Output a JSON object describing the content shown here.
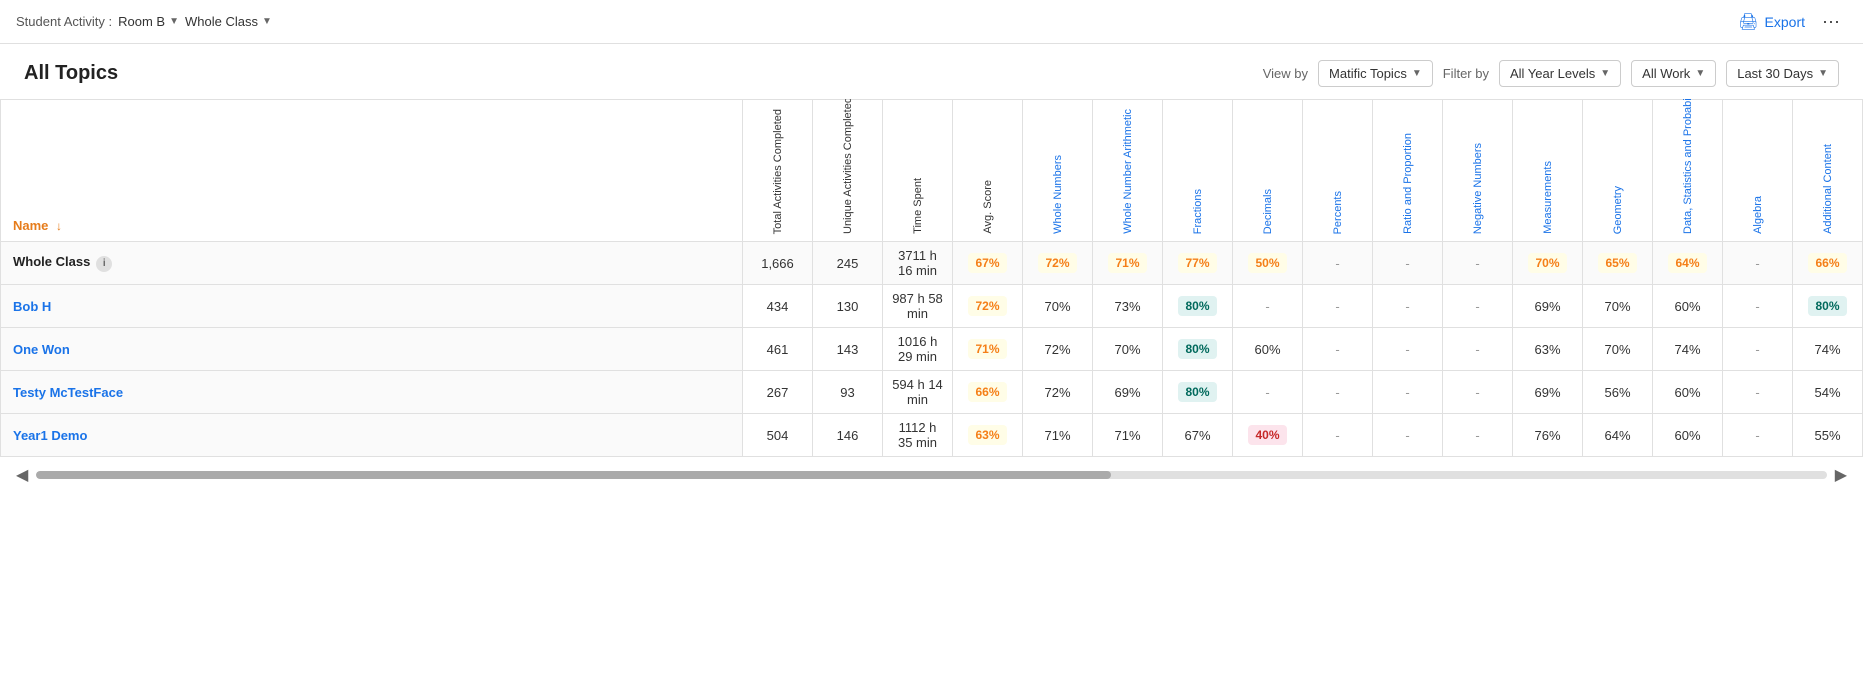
{
  "header": {
    "student_activity_label": "Student Activity :",
    "room_label": "Room B",
    "class_label": "Whole Class",
    "export_label": "Export",
    "more_icon": "···"
  },
  "title_section": {
    "title": "All Topics",
    "view_by_label": "View by",
    "view_by_value": "Matific Topics",
    "filter_by_label": "Filter by",
    "year_level_value": "All Year Levels",
    "work_value": "All Work",
    "date_value": "Last 30 Days"
  },
  "table": {
    "columns": {
      "name": "Name",
      "total_activities": "Total Activities Completed",
      "unique_activities": "Unique Activities Completed",
      "time_spent": "Time Spent",
      "avg_score": "Avg. Score",
      "whole_numbers": "Whole Numbers",
      "whole_number_arithmetic": "Whole Number Arithmetic",
      "fractions": "Fractions",
      "decimals": "Decimals",
      "percents": "Percents",
      "ratio_proportion": "Ratio and Proportion",
      "negative_numbers": "Negative Numbers",
      "measurements": "Measurements",
      "geometry": "Geometry",
      "data_statistics": "Data, Statistics and Probability",
      "algebra": "Algebra",
      "additional_content": "Additional Content"
    },
    "rows": [
      {
        "name": "Whole Class",
        "is_class": true,
        "total": "1,666",
        "unique": "245",
        "time": "3711 h 16 min",
        "avg": "67%",
        "avg_color": "yellow",
        "whole_numbers": "72%",
        "wn_color": "yellow",
        "wna": "71%",
        "wna_color": "yellow",
        "fractions": "77%",
        "frac_color": "yellow",
        "decimals": "50%",
        "dec_color": "yellow",
        "percents": "-",
        "ratio": "-",
        "negative": "-",
        "measurements": "70%",
        "meas_color": "yellow",
        "geometry": "65%",
        "geo_color": "yellow",
        "data_stats": "64%",
        "ds_color": "yellow",
        "algebra": "-",
        "additional": "66%",
        "add_color": "yellow"
      },
      {
        "name": "Bob H",
        "is_class": false,
        "total": "434",
        "unique": "130",
        "time": "987 h 58 min",
        "avg": "72%",
        "avg_color": "yellow",
        "whole_numbers": "70%",
        "wn_color": "plain",
        "wna": "73%",
        "wna_color": "plain",
        "fractions": "80%",
        "frac_color": "teal",
        "decimals": "-",
        "dec_color": "",
        "percents": "-",
        "ratio": "-",
        "negative": "-",
        "measurements": "69%",
        "meas_color": "plain",
        "geometry": "70%",
        "geo_color": "plain",
        "data_stats": "60%",
        "ds_color": "plain",
        "algebra": "-",
        "additional": "80%",
        "add_color": "teal"
      },
      {
        "name": "One Won",
        "is_class": false,
        "total": "461",
        "unique": "143",
        "time": "1016 h 29 min",
        "avg": "71%",
        "avg_color": "yellow",
        "whole_numbers": "72%",
        "wn_color": "plain",
        "wna": "70%",
        "wna_color": "plain",
        "fractions": "80%",
        "frac_color": "teal",
        "decimals": "60%",
        "dec_color": "plain",
        "percents": "-",
        "ratio": "-",
        "negative": "-",
        "measurements": "63%",
        "meas_color": "plain",
        "geometry": "70%",
        "geo_color": "plain",
        "data_stats": "74%",
        "ds_color": "plain",
        "algebra": "-",
        "additional": "74%",
        "add_color": "plain"
      },
      {
        "name": "Testy McTestFace",
        "is_class": false,
        "total": "267",
        "unique": "93",
        "time": "594 h 14 min",
        "avg": "66%",
        "avg_color": "yellow",
        "whole_numbers": "72%",
        "wn_color": "plain",
        "wna": "69%",
        "wna_color": "plain",
        "fractions": "80%",
        "frac_color": "teal",
        "decimals": "-",
        "dec_color": "",
        "percents": "-",
        "ratio": "-",
        "negative": "-",
        "measurements": "69%",
        "meas_color": "plain",
        "geometry": "56%",
        "geo_color": "plain",
        "data_stats": "60%",
        "ds_color": "plain",
        "algebra": "-",
        "additional": "54%",
        "add_color": "plain"
      },
      {
        "name": "Year1 Demo",
        "is_class": false,
        "total": "504",
        "unique": "146",
        "time": "1112 h 35 min",
        "avg": "63%",
        "avg_color": "yellow",
        "whole_numbers": "71%",
        "wn_color": "plain",
        "wna": "71%",
        "wna_color": "plain",
        "fractions": "67%",
        "frac_color": "plain",
        "decimals": "40%",
        "dec_color": "red",
        "percents": "-",
        "ratio": "-",
        "negative": "-",
        "measurements": "76%",
        "meas_color": "plain",
        "geometry": "64%",
        "geo_color": "plain",
        "data_stats": "60%",
        "ds_color": "plain",
        "algebra": "-",
        "additional": "55%",
        "add_color": "plain"
      }
    ]
  }
}
